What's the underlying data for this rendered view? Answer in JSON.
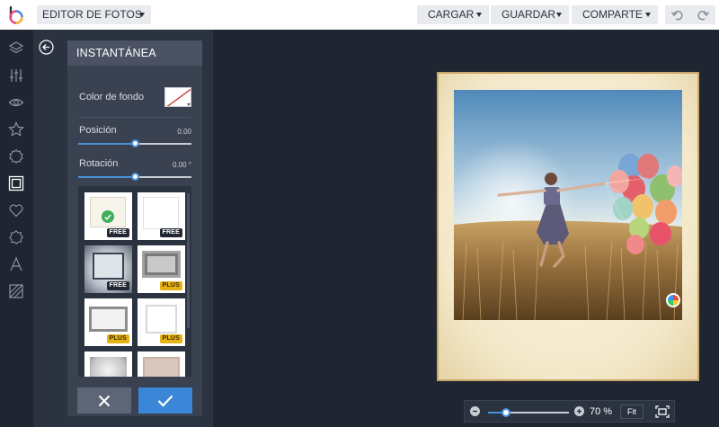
{
  "app": {
    "logo": "picmonkey-logo-icon"
  },
  "topbar": {
    "app_menu": "EDITOR DE FOTOS",
    "cargar": "CARGAR",
    "guardar": "GUARDAR",
    "comparte": "COMPARTE",
    "undo_icon": "undo-icon",
    "redo_icon": "redo-icon"
  },
  "rail": {
    "items": [
      "layers-icon",
      "adjust-icon",
      "eye-icon",
      "star-icon",
      "badge-icon",
      "frame-icon",
      "heart-icon",
      "texture-icon",
      "text-icon",
      "pattern-icon"
    ],
    "active": "frame-icon"
  },
  "panel": {
    "title": "INSTANTÁNEA",
    "color_label": "Color de fondo",
    "position": {
      "label": "Posición",
      "value": "0.00",
      "level": 0.5
    },
    "rotation": {
      "label": "Rotación",
      "value": "0.00 °",
      "level": 0.5
    },
    "frames": [
      {
        "badge": "FREE",
        "selected": true
      },
      {
        "badge": "FREE"
      },
      {
        "badge": "FREE"
      },
      {
        "badge": "PLUS"
      },
      {
        "badge": "PLUS"
      },
      {
        "badge": "PLUS"
      },
      {
        "badge": ""
      },
      {
        "badge": ""
      }
    ]
  },
  "zoom": {
    "value": "70 %",
    "level": 0.22,
    "fit": "Fit"
  },
  "colors": {
    "accent": "#3b86d6",
    "plus": "#e6b214",
    "free": "#222831"
  }
}
